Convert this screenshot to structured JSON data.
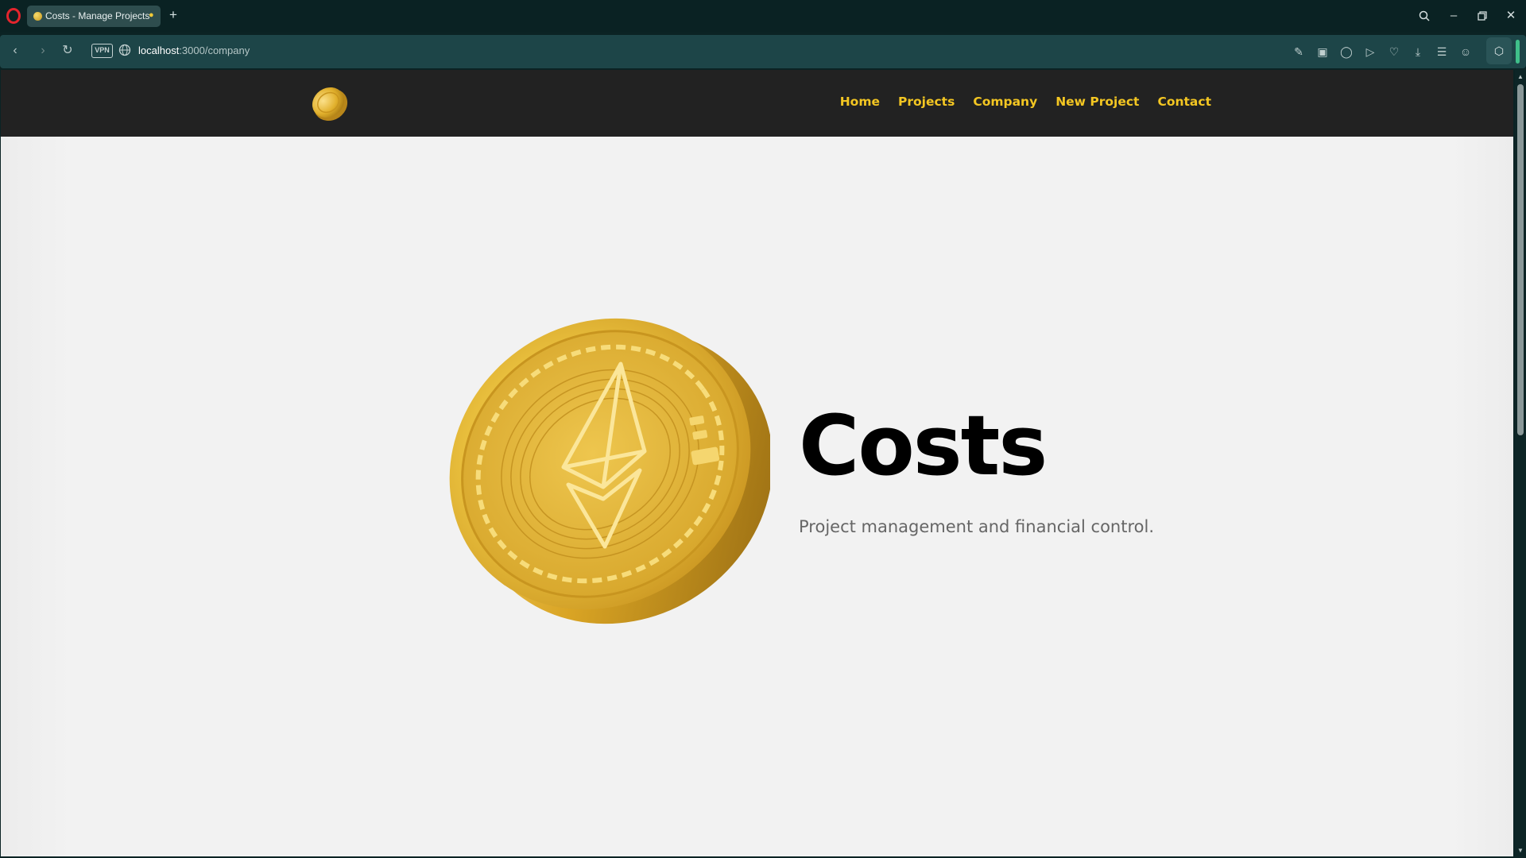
{
  "browser": {
    "tab": {
      "title": "Costs - Manage Projects",
      "favicon": "coin-icon",
      "badge": "lightbulb-icon"
    },
    "new_tab": "+",
    "window_controls": [
      "search-icon",
      "minimize-icon",
      "restore-icon",
      "close-icon"
    ],
    "address": {
      "host": "localhost",
      "path": ":3000/company",
      "vpn_label": "VPN"
    },
    "nav_icons": [
      "back-icon",
      "forward-icon",
      "reload-icon"
    ],
    "toolbar_icons": [
      "edit-icon",
      "camera-icon",
      "shield-icon",
      "play-icon",
      "heart-icon",
      "download-icon",
      "menu-icon",
      "account-icon",
      "extensions-icon"
    ],
    "scrollbar": {
      "position": 0.0
    }
  },
  "site": {
    "logo": "coin-logo",
    "nav": {
      "items": [
        "Home",
        "Projects",
        "Company",
        "New Project",
        "Contact"
      ]
    },
    "hero": {
      "title": "Costs",
      "subtitle": "Project management and financial control.",
      "image": "ethereum-coin-illustration"
    }
  },
  "colors": {
    "navbar_bg": "#222222",
    "nav_link": "#f3c622",
    "page_bg": "#f2f2f2",
    "title": "#000000",
    "subtitle": "#666666",
    "coin_gold": "#e8b92e"
  }
}
